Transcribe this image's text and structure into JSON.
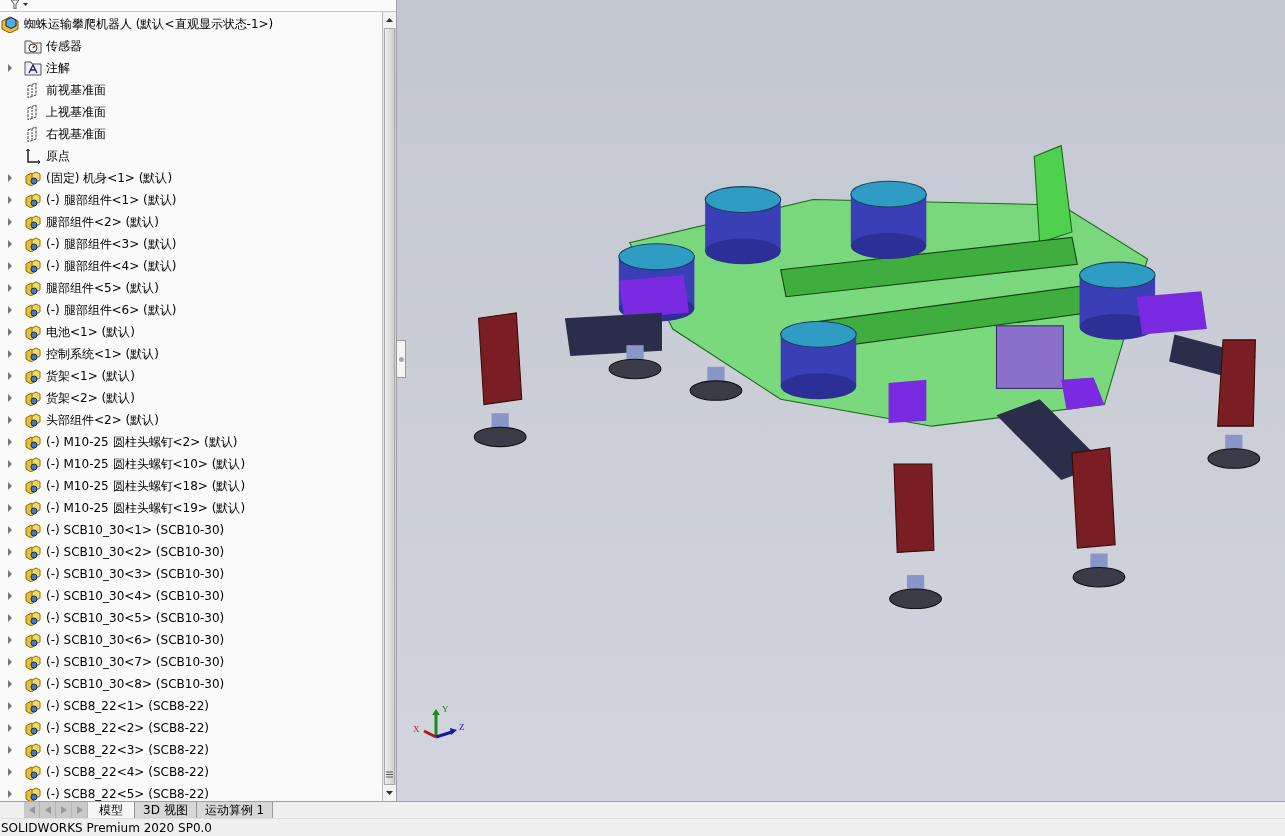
{
  "tree": {
    "root": "蜘蛛运输攀爬机器人 (默认<直观显示状态-1>)",
    "items": [
      {
        "kind": "sensors",
        "label": "传感器",
        "expandable": false
      },
      {
        "kind": "annotations",
        "label": "注解",
        "expandable": true
      },
      {
        "kind": "plane",
        "label": "前视基准面",
        "expandable": false
      },
      {
        "kind": "plane",
        "label": "上视基准面",
        "expandable": false
      },
      {
        "kind": "plane",
        "label": "右视基准面",
        "expandable": false
      },
      {
        "kind": "origin",
        "label": "原点",
        "expandable": false
      },
      {
        "kind": "component",
        "label": "(固定) 机身<1> (默认)",
        "expandable": true
      },
      {
        "kind": "component",
        "label": "(-) 腿部组件<1> (默认)",
        "expandable": true
      },
      {
        "kind": "component",
        "label": "腿部组件<2> (默认)",
        "expandable": true
      },
      {
        "kind": "component",
        "label": "(-) 腿部组件<3> (默认)",
        "expandable": true
      },
      {
        "kind": "component",
        "label": "(-) 腿部组件<4> (默认)",
        "expandable": true
      },
      {
        "kind": "component",
        "label": "腿部组件<5> (默认)",
        "expandable": true
      },
      {
        "kind": "component",
        "label": "(-) 腿部组件<6> (默认)",
        "expandable": true
      },
      {
        "kind": "component",
        "label": "电池<1> (默认)",
        "expandable": true
      },
      {
        "kind": "component",
        "label": "控制系统<1> (默认)",
        "expandable": true
      },
      {
        "kind": "component",
        "label": "货架<1> (默认)",
        "expandable": true
      },
      {
        "kind": "component",
        "label": "货架<2> (默认)",
        "expandable": true
      },
      {
        "kind": "component",
        "label": "头部组件<2> (默认)",
        "expandable": true
      },
      {
        "kind": "component",
        "label": "(-) M10-25 圆柱头螺钉<2> (默认)",
        "expandable": true
      },
      {
        "kind": "component",
        "label": "(-) M10-25 圆柱头螺钉<10> (默认)",
        "expandable": true
      },
      {
        "kind": "component",
        "label": "(-) M10-25 圆柱头螺钉<18> (默认)",
        "expandable": true
      },
      {
        "kind": "component",
        "label": "(-) M10-25 圆柱头螺钉<19> (默认)",
        "expandable": true
      },
      {
        "kind": "component",
        "label": "(-) SCB10_30<1> (SCB10-30)",
        "expandable": true
      },
      {
        "kind": "component",
        "label": "(-) SCB10_30<2> (SCB10-30)",
        "expandable": true
      },
      {
        "kind": "component",
        "label": "(-) SCB10_30<3> (SCB10-30)",
        "expandable": true
      },
      {
        "kind": "component",
        "label": "(-) SCB10_30<4> (SCB10-30)",
        "expandable": true
      },
      {
        "kind": "component",
        "label": "(-) SCB10_30<5> (SCB10-30)",
        "expandable": true
      },
      {
        "kind": "component",
        "label": "(-) SCB10_30<6> (SCB10-30)",
        "expandable": true
      },
      {
        "kind": "component",
        "label": "(-) SCB10_30<7> (SCB10-30)",
        "expandable": true
      },
      {
        "kind": "component",
        "label": "(-) SCB10_30<8> (SCB10-30)",
        "expandable": true
      },
      {
        "kind": "component",
        "label": "(-) SCB8_22<1> (SCB8-22)",
        "expandable": true
      },
      {
        "kind": "component",
        "label": "(-) SCB8_22<2> (SCB8-22)",
        "expandable": true
      },
      {
        "kind": "component",
        "label": "(-) SCB8_22<3> (SCB8-22)",
        "expandable": true
      },
      {
        "kind": "component",
        "label": "(-) SCB8_22<4> (SCB8-22)",
        "expandable": true
      },
      {
        "kind": "component",
        "label": "(-) SCB8_22<5> (SCB8-22)",
        "expandable": true
      }
    ]
  },
  "tabs": [
    {
      "label": "模型",
      "selected": true
    },
    {
      "label": "3D 视图",
      "selected": false
    },
    {
      "label": "运动算例 1",
      "selected": false
    }
  ],
  "triad": {
    "x": "X",
    "y": "Y",
    "z": "Z"
  },
  "status_bar": "SOLIDWORKS Premium 2020 SP0.0"
}
